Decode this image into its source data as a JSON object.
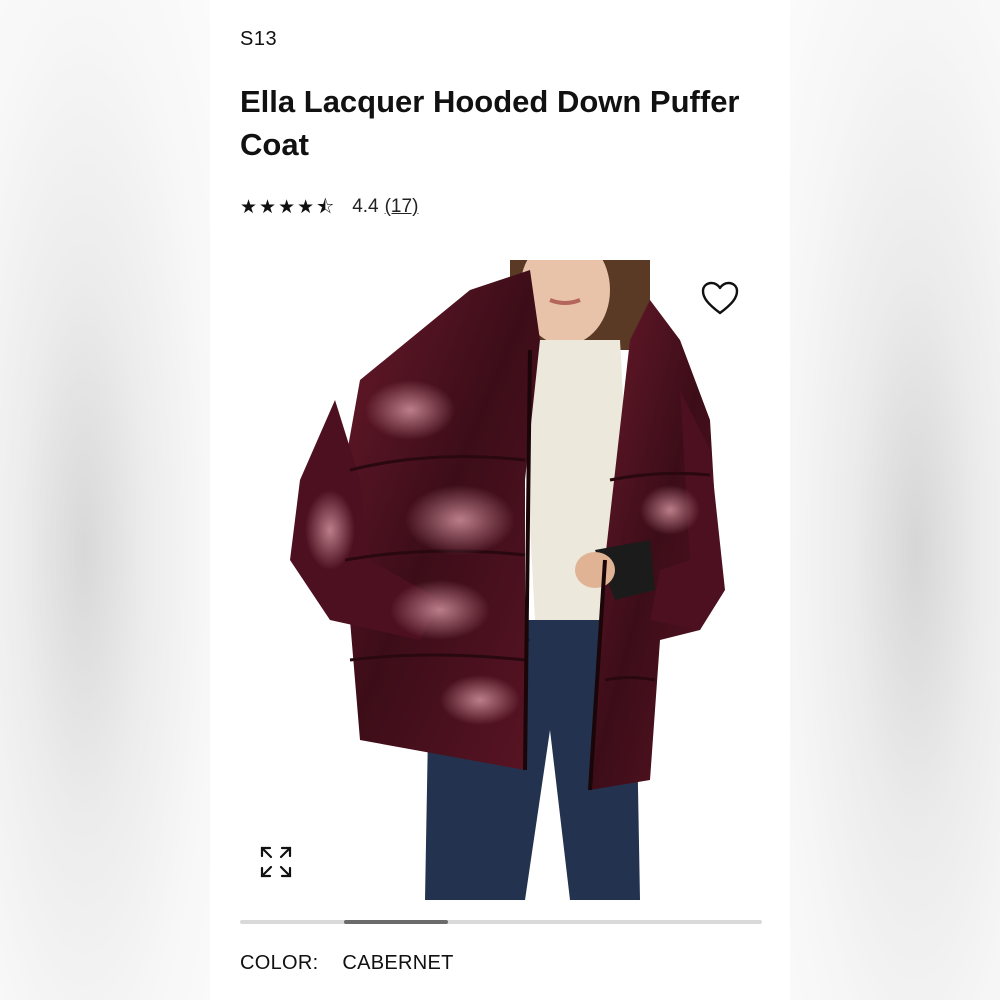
{
  "product": {
    "brand": "S13",
    "title": "Ella Lacquer Hooded Down Puffer Coat",
    "rating": {
      "stars": 4.4,
      "value_text": "4.4",
      "reviews_text": "(17)"
    },
    "color": {
      "label": "COLOR:",
      "value": "CABERNET"
    }
  },
  "gallery": {
    "slide_position": 0.2,
    "image_subject": "model wearing glossy burgundy hooded puffer coat"
  },
  "icons": {
    "favorite": "heart-icon",
    "zoom": "expand-icon",
    "star": "star-icon"
  },
  "colors": {
    "coat": "#4a1220",
    "jeans": "#22324f",
    "accent_text": "#111111"
  }
}
